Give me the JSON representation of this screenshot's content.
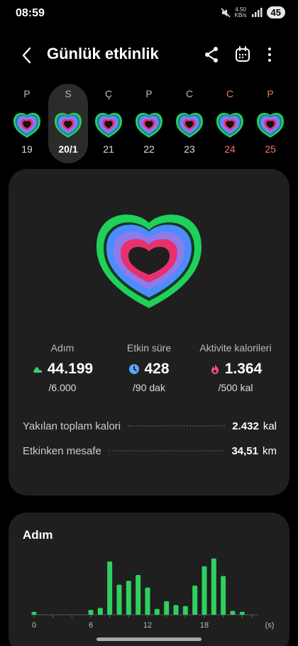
{
  "status_bar": {
    "time": "08:59",
    "net_speed": "4.50",
    "net_unit": "KB/s",
    "battery": "45"
  },
  "header": {
    "title": "Günlük etkinlik"
  },
  "week": [
    {
      "letter": "P",
      "day": "19",
      "selected": false,
      "weekend": false
    },
    {
      "letter": "S",
      "day": "20/1",
      "selected": true,
      "weekend": false
    },
    {
      "letter": "Ç",
      "day": "21",
      "selected": false,
      "weekend": false
    },
    {
      "letter": "P",
      "day": "22",
      "selected": false,
      "weekend": false
    },
    {
      "letter": "C",
      "day": "23",
      "selected": false,
      "weekend": false
    },
    {
      "letter": "C",
      "day": "24",
      "selected": false,
      "weekend": true
    },
    {
      "letter": "P",
      "day": "25",
      "selected": false,
      "weekend": true
    }
  ],
  "stats": [
    {
      "label": "Adım",
      "value": "44.199",
      "goal": "/6.000",
      "icon": "shoe-icon",
      "color": "#3ad06a"
    },
    {
      "label": "Etkin süre",
      "value": "428",
      "goal": "/90 dak",
      "icon": "clock-icon",
      "color": "#5ba8ff"
    },
    {
      "label": "Aktivite kalorileri",
      "value": "1.364",
      "goal": "/500 kal",
      "icon": "flame-icon",
      "color": "#f0508a"
    }
  ],
  "summary": {
    "calories_label": "Yakılan toplam kalori",
    "calories_value": "2.432",
    "calories_unit": "kal",
    "distance_label": "Etkinken mesafe",
    "distance_value": "34,51",
    "distance_unit": "km"
  },
  "colors": {
    "steps": "#2fd060",
    "time": "#5ba8ff",
    "calories": "#f0508a",
    "ring_outer": "#1fd15a",
    "ring_blue": "#4d8cff",
    "ring_violet": "#8e7bea",
    "ring_pink": "#e8306e"
  },
  "chart_data": {
    "type": "bar",
    "title": "Adım",
    "x_unit": "(s)",
    "x_ticks": [
      "0",
      "6",
      "12",
      "18"
    ],
    "hours": [
      0,
      1,
      2,
      3,
      4,
      5,
      6,
      7,
      8,
      9,
      10,
      11,
      12,
      13,
      14,
      15,
      16,
      17,
      18,
      19,
      20,
      21,
      22,
      23
    ],
    "values": [
      3,
      0,
      0,
      0,
      0,
      0,
      5,
      7,
      55,
      31,
      35,
      41,
      28,
      6,
      14,
      10,
      9,
      30,
      50,
      58,
      40,
      4,
      3,
      0
    ],
    "ylim": [
      0,
      60
    ]
  }
}
